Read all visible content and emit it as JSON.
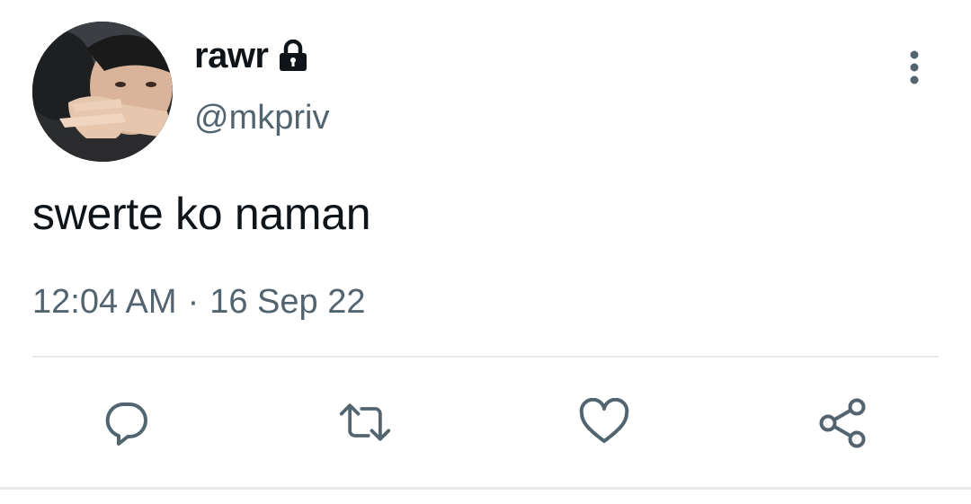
{
  "tweet": {
    "display_name": "rawr",
    "handle": "@mkpriv",
    "text": "swerte ko naman",
    "time": "12:04 AM",
    "separator": "·",
    "date": "16 Sep 22",
    "protected_icon": "lock-icon",
    "more_icon": "more-vertical-icon"
  },
  "actions": {
    "reply_icon": "reply-icon",
    "retweet_icon": "retweet-icon",
    "like_icon": "heart-icon",
    "share_icon": "share-icon"
  },
  "colors": {
    "text_primary": "#0f1419",
    "text_secondary": "#536471",
    "icon": "#536471",
    "divider": "#e7e9ea"
  }
}
